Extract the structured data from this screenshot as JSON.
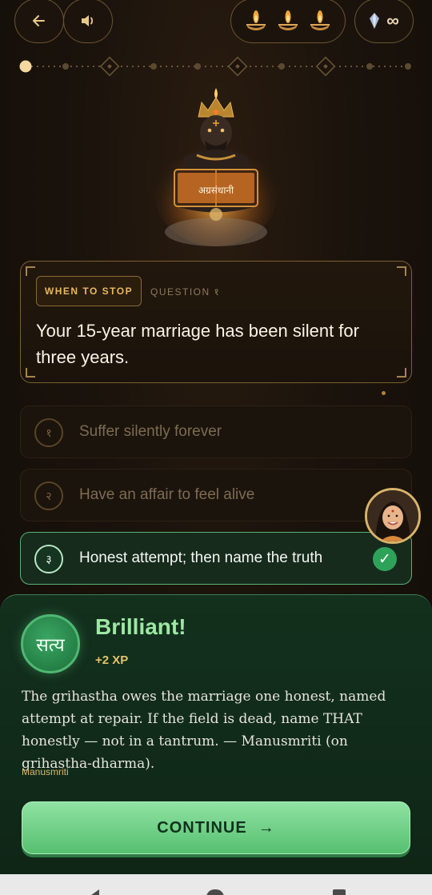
{
  "header": {
    "back_icon": "arrow-left-icon",
    "sound_icon": "speaker-icon",
    "lamps": [
      "diya-lamp-icon",
      "diya-lamp-icon",
      "diya-lamp-icon"
    ],
    "gems_value": "∞",
    "gem_icon": "crystal-icon"
  },
  "progress": {
    "current_step": 1,
    "total_steps": 5
  },
  "hero": {
    "book_text": "अग्रसंधानी"
  },
  "question": {
    "category": "WHEN TO STOP",
    "label": "QUESTION १",
    "text": "Your 15-year marriage has been silent for three years."
  },
  "options": [
    {
      "num": "१",
      "text": "Suffer silently forever",
      "state": "disabled"
    },
    {
      "num": "२",
      "text": "Have an affair to feel alive",
      "state": "disabled"
    },
    {
      "num": "३",
      "text": "Honest attempt; then name the truth",
      "state": "correct"
    }
  ],
  "check_glyph": "✓",
  "result": {
    "seal_text": "सत्य",
    "title": "Brilliant!",
    "xp": "+2 XP",
    "explanation": "The grihastha owes the marriage one honest, named attempt at repair. If the field is dead, name THAT honestly — not in a tantrum. — Manusmriti (on grihastha-dharma).",
    "source": "Manusmriti",
    "continue_label": "CONTINUE",
    "continue_arrow": "→"
  },
  "colors": {
    "accent_gold": "#e8b85c",
    "correct_green": "#59b274",
    "result_bg": "#13301d"
  }
}
